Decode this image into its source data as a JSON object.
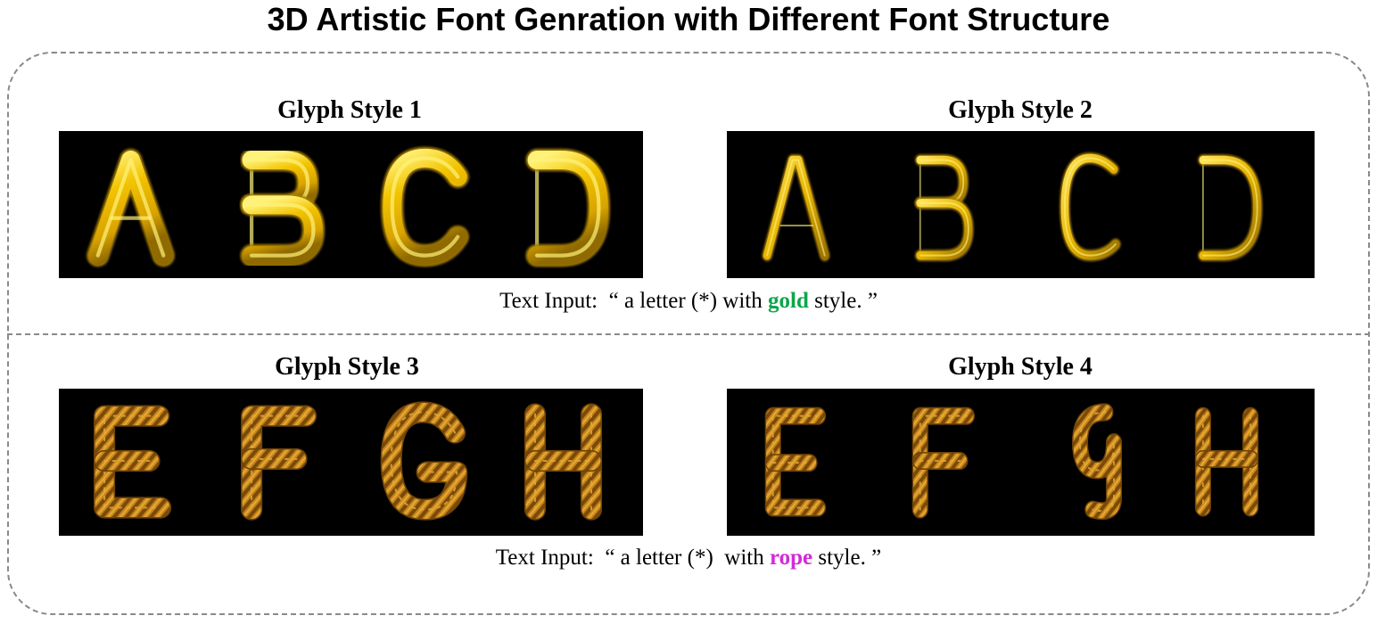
{
  "title": "3D Artistic Font Genration with Different Font Structure",
  "rows": [
    {
      "panels": [
        {
          "label": "Glyph Style 1",
          "letters": [
            "A",
            "B",
            "C",
            "D"
          ]
        },
        {
          "label": "Glyph Style 2",
          "letters": [
            "A",
            "B",
            "C",
            "D"
          ]
        }
      ],
      "caption": {
        "prefix": "Text Input:  “ a letter (*) with ",
        "keyword": "gold",
        "suffix": " style. ”"
      },
      "material": "gold",
      "keyword_color": "#0ca64b"
    },
    {
      "panels": [
        {
          "label": "Glyph Style 3",
          "letters": [
            "E",
            "F",
            "G",
            "H"
          ]
        },
        {
          "label": "Glyph Style 4",
          "letters": [
            "E",
            "F",
            "G",
            "H"
          ]
        }
      ],
      "caption": {
        "prefix": "Text Input:  “ a letter (*)  with ",
        "keyword": "rope",
        "suffix": " style. ”"
      },
      "material": "rope",
      "keyword_color": "#d32ad8"
    }
  ],
  "colors": {
    "gold_fill": "#f2c300",
    "gold_highlight": "#fff27a",
    "gold_shadow": "#a37c00",
    "rope_fill": "#c78516",
    "rope_dark": "#6e4308",
    "rope_light": "#e4a93a",
    "frame_border": "#8a8a8a"
  }
}
